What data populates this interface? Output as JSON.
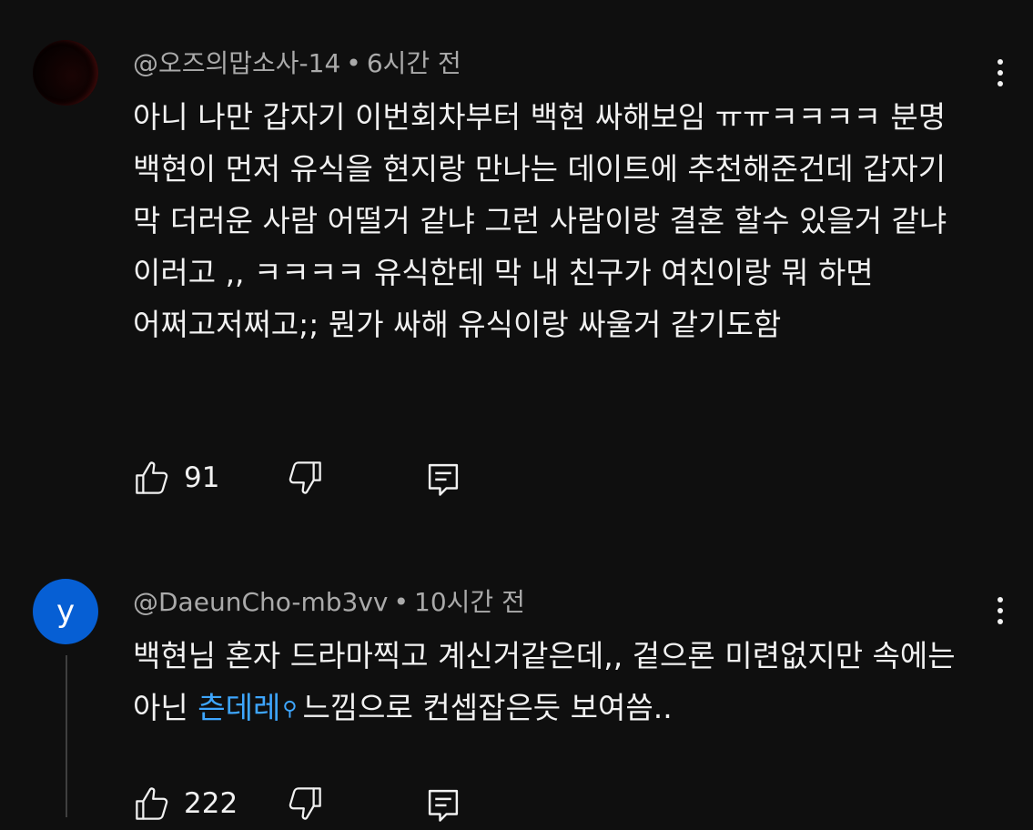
{
  "comments": [
    {
      "author": "@오즈의맙소사-14",
      "separator": "•",
      "time": "6시간 전",
      "text": "아니 나만 갑자기 이번회차부터 백현 싸해보임 ㅠㅠㅋㅋㅋㅋ 분명 백현이 먼저 유식을 현지랑 만나는 데이트에 추천해준건데 갑자기 막 더러운 사람 어떨거 같냐 그런 사람이랑 결혼 할수 있을거 같냐 이러고 ,, ㅋㅋㅋㅋ 유식한테 막 내 친구가 여친이랑 뭐 하면 어쩌고저쩌고;; 뭔가 싸해 유식이랑 싸울거 같기도함",
      "likes": "91",
      "avatar_color": "#0a0101"
    },
    {
      "author": "@DaeunCho-mb3vv",
      "separator": "•",
      "time": "10시간 전",
      "avatar_letter": "y",
      "avatar_color": "#065fd4",
      "text_before": "백현님 혼자 드라마찍고 계신거같은데,, 겉으론 미련없지만 속에는 아닌 ",
      "link_text": "츤데레",
      "text_after": "느낌으로 컨셉잡은듯 보여씀..",
      "likes": "222"
    }
  ],
  "icons": {
    "more": "more-vert-icon",
    "like": "thumbs-up-icon",
    "dislike": "thumbs-down-icon",
    "reply": "reply-comment-icon",
    "search": "search-icon"
  },
  "colors": {
    "background": "#0f0f0f",
    "meta_text": "#aaaaaa",
    "link": "#3ea6ff"
  }
}
